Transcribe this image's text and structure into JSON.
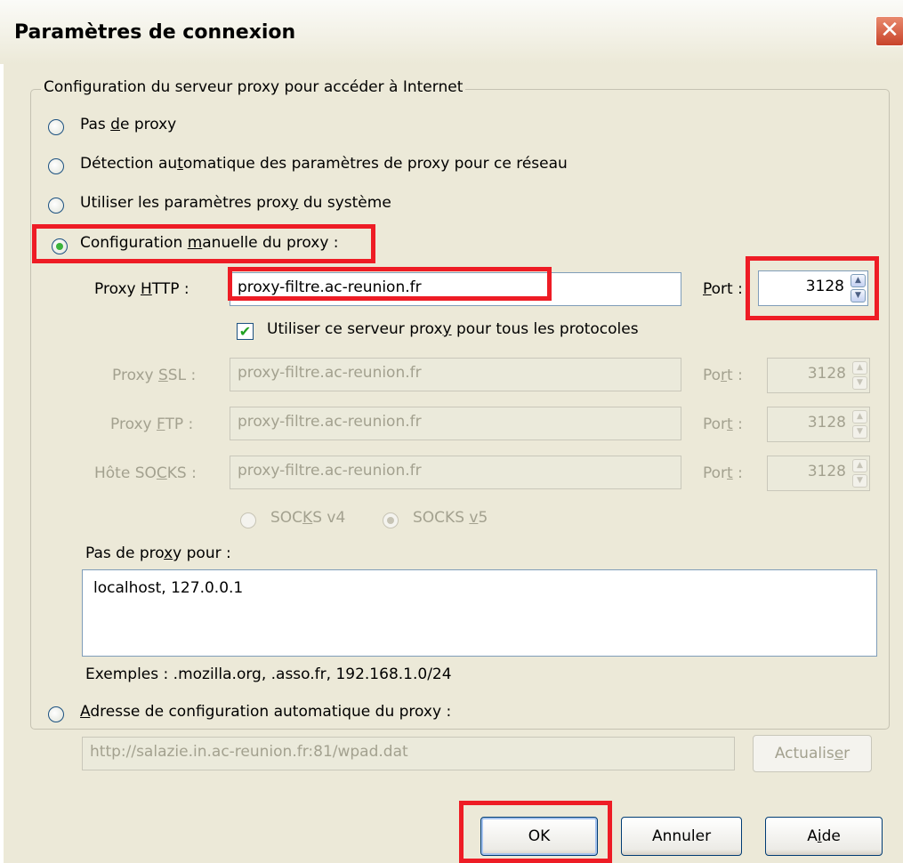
{
  "window": {
    "title": "Paramètres de connexion",
    "close_glyph": "✕"
  },
  "group": {
    "legend": "Configuration du serveur proxy pour accéder à Internet"
  },
  "options": {
    "no_proxy": {
      "pre": "Pas ",
      "key": "d",
      "post": "e proxy",
      "selected": false
    },
    "auto_detect": {
      "pre": "Détection au",
      "key": "t",
      "post": "omatique des paramètres de proxy pour ce réseau",
      "selected": false
    },
    "system": {
      "pre": "Utiliser les paramètres prox",
      "key": "y",
      "post": " du système",
      "selected": false
    },
    "manual": {
      "pre": "Configuration ",
      "key": "m",
      "post": "anuelle du proxy :",
      "selected": true
    },
    "auto_url": {
      "pre": "",
      "key": "A",
      "post": "dresse de configuration automatique du proxy :",
      "selected": false
    }
  },
  "http": {
    "label_pre": "Proxy ",
    "label_key": "H",
    "label_post": "TTP :",
    "value": "proxy-filtre.ac-reunion.fr",
    "port_label_key": "P",
    "port_label_post": "ort :",
    "port": "3128"
  },
  "same_proxy": {
    "pre": "Utiliser ce serveur prox",
    "key": "y",
    "post": " pour tous les protocoles",
    "checked": true,
    "mark": "✔"
  },
  "ssl": {
    "label_pre": "Proxy ",
    "label_key": "S",
    "label_post": "SL :",
    "value": "proxy-filtre.ac-reunion.fr",
    "port_pre": "Po",
    "port_key": "r",
    "port_post": "t :",
    "port": "3128"
  },
  "ftp": {
    "label_pre": "Proxy ",
    "label_key": "F",
    "label_post": "TP :",
    "value": "proxy-filtre.ac-reunion.fr",
    "port_pre": "Por",
    "port_key": "t",
    "port_post": " :",
    "port": "3128"
  },
  "socks": {
    "label_pre": "Hôte SO",
    "label_key": "C",
    "label_post": "KS :",
    "value": "proxy-filtre.ac-reunion.fr",
    "port_pre": "Por",
    "port_key": "t",
    "port_post": " :",
    "port": "3128"
  },
  "socks_version": {
    "v4": {
      "pre": "SOC",
      "key": "K",
      "post": "S v4",
      "selected": false
    },
    "v5": {
      "pre": "SOCKS ",
      "key": "v",
      "post": "5",
      "selected": true
    }
  },
  "no_proxy_for": {
    "pre": "Pas de pro",
    "key": "x",
    "post": "y pour :",
    "value": "localhost, 127.0.0.1",
    "examples": "Exemples : .mozilla.org, .asso.fr, 192.168.1.0/24"
  },
  "auto_config": {
    "url": "http://salazie.in.ac-reunion.fr:81/wpad.dat",
    "reload_pre": "Actualis",
    "reload_key": "e",
    "reload_post": "r"
  },
  "buttons": {
    "ok": "OK",
    "cancel": "Annuler",
    "help_pre": "A",
    "help_key": "i",
    "help_post": "de"
  },
  "spin_up": "▲",
  "spin_down": "▼",
  "colors": {
    "highlight": "#ee1c25",
    "radio_selected": "#3bb33b",
    "disabled_text": "#a3a18f",
    "dialog_bg": "#ece9d8"
  }
}
